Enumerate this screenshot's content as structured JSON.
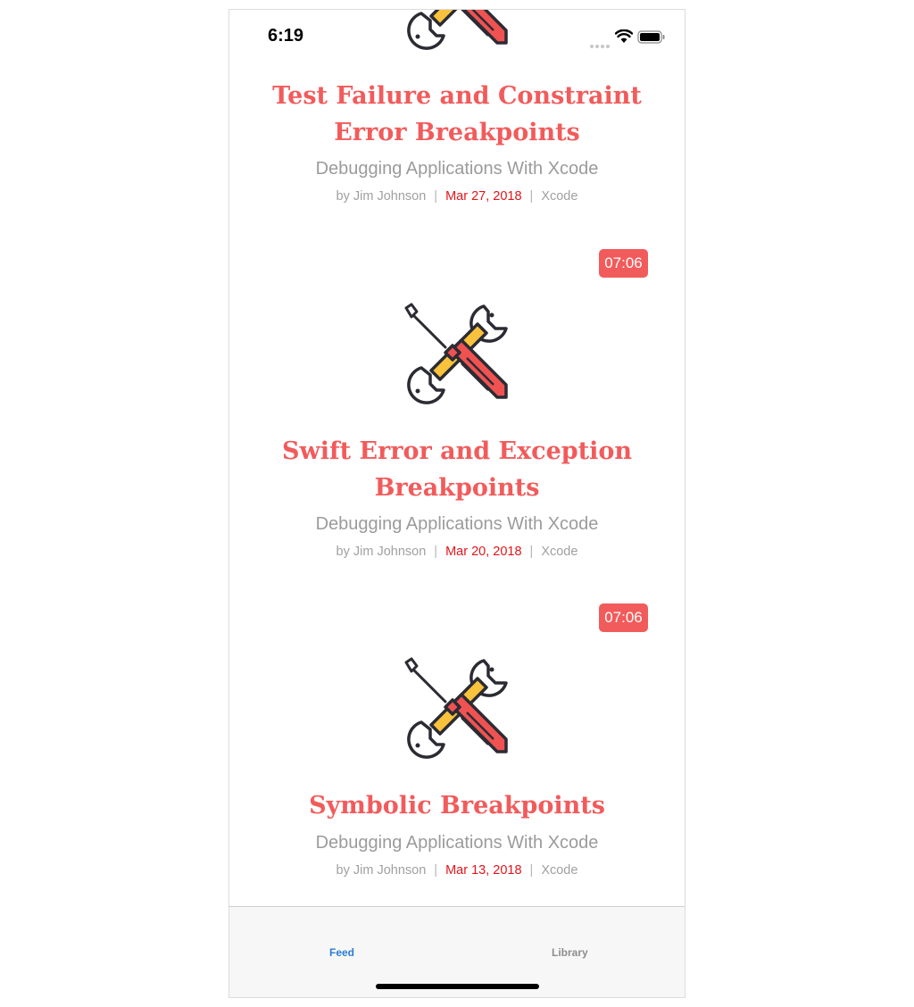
{
  "status_bar": {
    "time": "6:19"
  },
  "posts": [
    {
      "title_line1": "Test Failure and Constraint",
      "title_line2": "Error Breakpoints",
      "course": "Debugging Applications With Xcode",
      "author": "by Jim Johnson",
      "date": "Mar 27, 2018",
      "category": "Xcode"
    },
    {
      "duration": "07:06",
      "title_line1": "Swift Error and Exception",
      "title_line2": "Breakpoints",
      "course": "Debugging Applications With Xcode",
      "author": "by Jim Johnson",
      "date": "Mar 20, 2018",
      "category": "Xcode"
    },
    {
      "duration": "07:06",
      "title_line1": "Symbolic Breakpoints",
      "course": "Debugging Applications With Xcode",
      "author": "by Jim Johnson",
      "date": "Mar 13, 2018",
      "category": "Xcode"
    }
  ],
  "separator": "|",
  "icon": "wrench-screwdriver-icon",
  "colors": {
    "accent": "#f25b5b",
    "date": "#e3141a",
    "tab_active": "#2a7dd6",
    "tab_inactive": "#8e8e8e"
  },
  "tab_bar": {
    "feed_label": "Feed",
    "library_label": "Library",
    "active": "Feed"
  }
}
